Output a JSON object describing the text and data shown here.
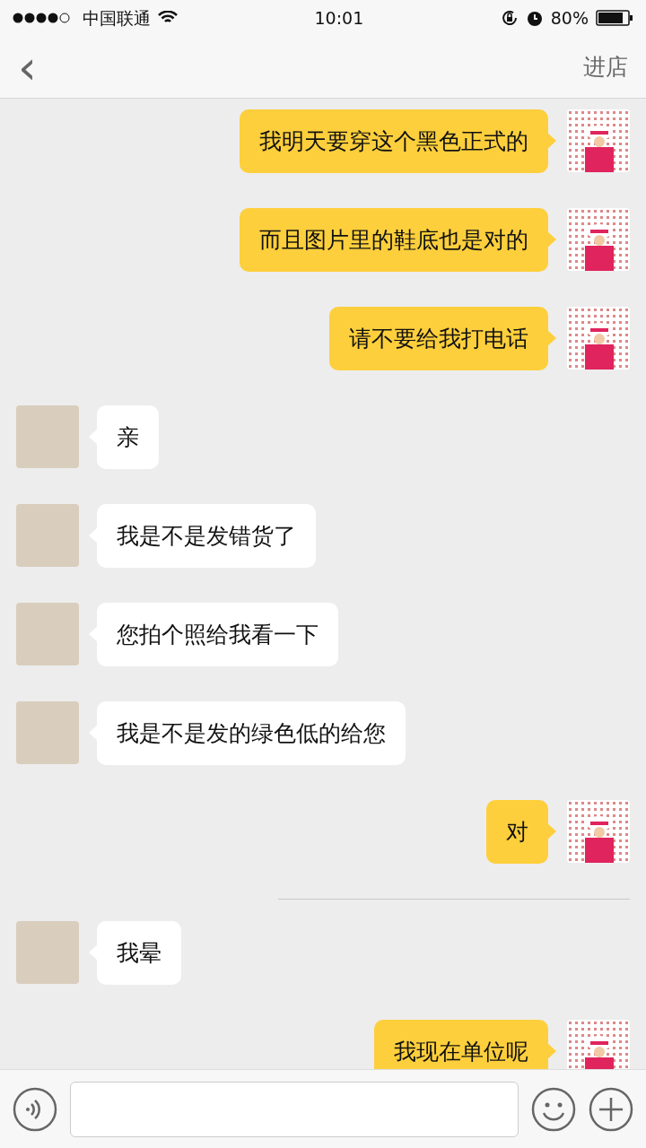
{
  "status_bar": {
    "carrier": "中国联通",
    "time": "10:01",
    "battery": "80%"
  },
  "nav": {
    "back": "‹",
    "action": "进店"
  },
  "messages": [
    {
      "kind": "out",
      "text": "我明天要穿这个黑色正式的"
    },
    {
      "kind": "out",
      "text": "而且图片里的鞋底也是对的"
    },
    {
      "kind": "out",
      "text": "请不要给我打电话"
    },
    {
      "kind": "in",
      "text": "亲"
    },
    {
      "kind": "in",
      "text": "我是不是发错货了"
    },
    {
      "kind": "in",
      "text": "您拍个照给我看一下"
    },
    {
      "kind": "in",
      "text": "我是不是发的绿色低的给您"
    },
    {
      "kind": "out",
      "text": "对"
    },
    {
      "kind": "divider"
    },
    {
      "kind": "in",
      "text": "我晕"
    },
    {
      "kind": "out",
      "text": "我现在单位呢"
    }
  ]
}
